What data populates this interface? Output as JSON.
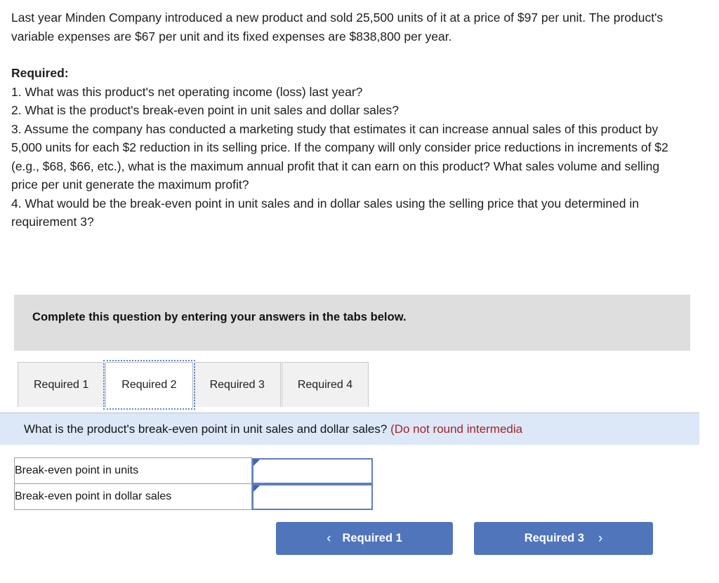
{
  "problem": {
    "statement": "Last year Minden Company introduced a new product and sold 25,500 units of it at a price of $97 per unit. The product's variable expenses are $67 per unit and its fixed expenses are $838,800 per year.",
    "required_heading": "Required:",
    "requirements": [
      "1. What was this product's net operating income (loss) last year?",
      "2. What is the product's break-even point in unit sales and dollar sales?",
      "3. Assume the company has conducted a marketing study that estimates it can increase annual sales of this product by 5,000 units for each $2 reduction in its selling price. If the company will only consider price reductions in increments of $2 (e.g., $68, $66, etc.), what is the maximum annual profit that it can earn on this product? What sales volume and selling price per unit generate the maximum profit?",
      "4. What would be the break-even point in unit sales and in dollar sales using the selling price that you determined in requirement 3?"
    ]
  },
  "banner": {
    "text": "Complete this question by entering your answers in the tabs below.",
    "background_color": "#dedede"
  },
  "tabs": {
    "active_index": 1,
    "items": [
      {
        "label": "Required 1"
      },
      {
        "label": "Required 2"
      },
      {
        "label": "Required 3"
      },
      {
        "label": "Required 4"
      }
    ]
  },
  "question_bar": {
    "question": "What is the product's break-even point in unit sales and dollar sales?",
    "note": "(Do not round intermedia",
    "note_color": "#a22323",
    "background_color": "#dce8f7"
  },
  "answer_table": {
    "rows": [
      {
        "label": "Break-even point in units",
        "value": "",
        "placeholder": ""
      },
      {
        "label": "Break-even point in dollar sales",
        "value": "",
        "placeholder": ""
      }
    ]
  },
  "nav": {
    "prev_label": "Required 1",
    "prev_icon": "chevron-left-icon",
    "prev_glyph": "‹",
    "next_label": "Required 3",
    "next_icon": "chevron-right-icon",
    "next_glyph": "›",
    "button_color": "#5075bb"
  }
}
